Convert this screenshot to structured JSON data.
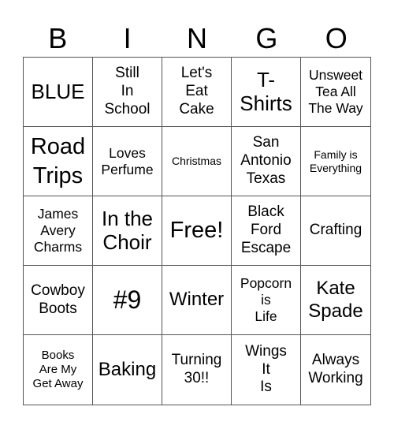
{
  "header": {
    "letters": [
      "B",
      "I",
      "N",
      "G",
      "O"
    ]
  },
  "board": {
    "rows": [
      [
        "BLUE",
        "Still\nIn\nSchool",
        "Let's\nEat\nCake",
        "T-\nShirts",
        "Unsweet\nTea All\nThe Way"
      ],
      [
        "Road\nTrips",
        "Loves\nPerfume",
        "Christmas",
        "San\nAntonio\nTexas",
        "Family is\nEverything"
      ],
      [
        "James\nAvery\nCharms",
        "In the\nChoir",
        "Free!",
        "Black\nFord\nEscape",
        "Crafting"
      ],
      [
        "Cowboy\nBoots",
        "#9",
        "Winter",
        "Popcorn\nis\nLife",
        "Kate\nSpade"
      ],
      [
        "Books\nAre My\nGet Away",
        "Baking",
        "Turning\n30!!",
        "Wings\nIt\nIs",
        "Always\nWorking"
      ]
    ]
  }
}
